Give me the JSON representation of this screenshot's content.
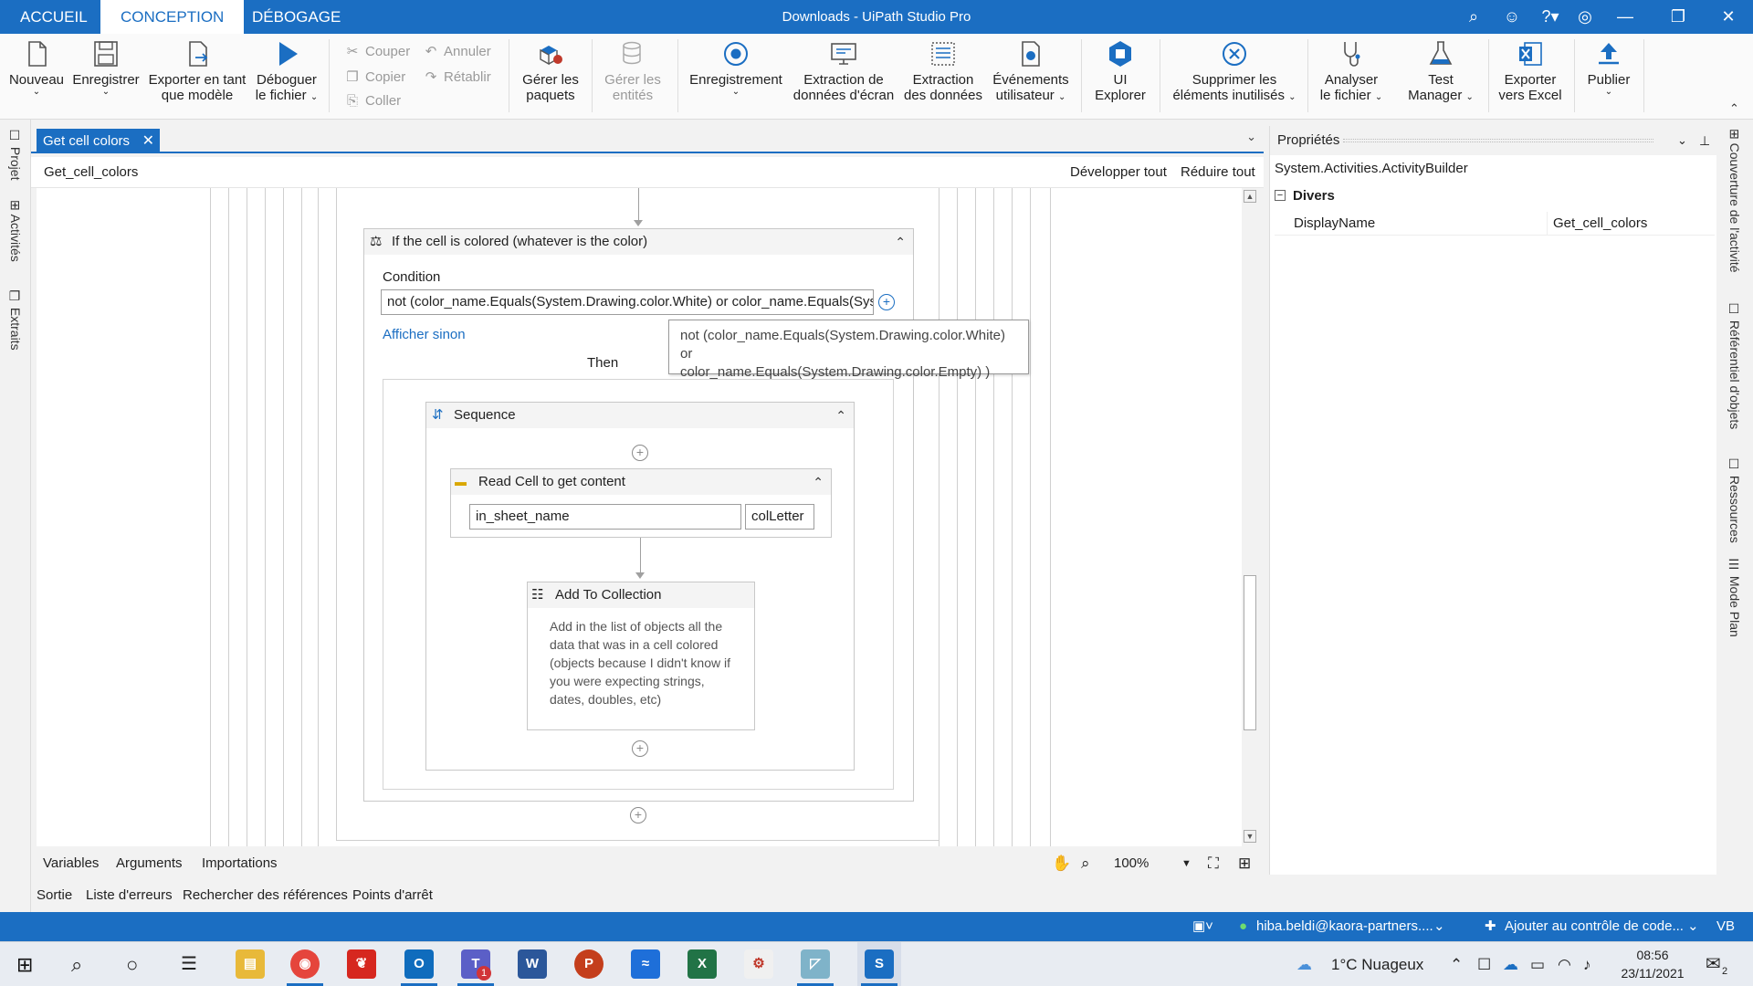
{
  "app": {
    "window_title": "Downloads - UiPath Studio Pro",
    "tabs": [
      "ACCUEIL",
      "CONCEPTION",
      "DÉBOGAGE"
    ]
  },
  "ribbon": {
    "nouveau": "Nouveau",
    "enregistrer": "Enregistrer",
    "exporter_modele_1": "Exporter en tant",
    "exporter_modele_2": "que modèle",
    "deboguer_1": "Déboguer",
    "deboguer_2": "le fichier",
    "couper": "Couper",
    "copier": "Copier",
    "coller": "Coller",
    "annuler": "Annuler",
    "retablir": "Rétablir",
    "gerer_paquets_1": "Gérer les",
    "gerer_paquets_2": "paquets",
    "gerer_entites_1": "Gérer les",
    "gerer_entites_2": "entités",
    "enregistrement": "Enregistrement",
    "extraction_ecran_1": "Extraction de",
    "extraction_ecran_2": "données d'écran",
    "extraction_donnees_1": "Extraction",
    "extraction_donnees_2": "des données",
    "evenements_1": "Événements",
    "evenements_2": "utilisateur",
    "ui_explorer_1": "UI",
    "ui_explorer_2": "Explorer",
    "supprimer_1": "Supprimer les",
    "supprimer_2": "éléments inutilisés",
    "analyser_1": "Analyser",
    "analyser_2": "le fichier",
    "test_1": "Test",
    "test_2": "Manager",
    "exporter_excel_1": "Exporter",
    "exporter_excel_2": "vers Excel",
    "publier": "Publier"
  },
  "left_rail": [
    "Projet",
    "Activités",
    "Extraits"
  ],
  "right_rail": [
    "Couverture de l'activité",
    "Référentiel d'objets",
    "Ressources",
    "Mode Plan"
  ],
  "document": {
    "tab": "Get cell colors",
    "breadcrumb": "Get_cell_colors",
    "expand_all": "Développer tout",
    "collapse_all": "Réduire tout"
  },
  "workflow": {
    "if_title": "If the cell is colored (whatever is the color)",
    "condition_label": "Condition",
    "condition_value": "not (color_name.Equals(System.Drawing.color.White) or color_name.Equals(System.Drawing.color.Empty) )",
    "show_else": "Afficher sinon",
    "then_label": "Then",
    "tooltip_line1": "not (color_name.Equals(System.Drawing.color.White) or",
    "tooltip_line2": "color_name.Equals(System.Drawing.color.Empty) )",
    "sequence_title": "Sequence",
    "readcell_title": "Read Cell to get content",
    "readcell_sheet": "in_sheet_name",
    "readcell_col": "colLetter",
    "addcollection_title": "Add To Collection",
    "addcollection_desc": "Add in the list of objects all the data that was in a cell colored (objects because I didn't know if you were expecting strings, dates, doubles, etc)"
  },
  "designer_bottom": {
    "tabs": [
      "Variables",
      "Arguments",
      "Importations"
    ],
    "zoom": "100%"
  },
  "output_tabs": [
    "Sortie",
    "Liste d'erreurs",
    "Rechercher des références",
    "Points d'arrêt"
  ],
  "properties": {
    "title": "Propriétés",
    "type": "System.Activities.ActivityBuilder",
    "category": "Divers",
    "rows": [
      {
        "name": "DisplayName",
        "value": "Get_cell_colors"
      }
    ]
  },
  "statusbar": {
    "user": "hiba.beldi@kaora-partners....",
    "source_control": "Ajouter au contrôle de code...",
    "lang": "VB"
  },
  "taskbar": {
    "weather": "1°C  Nuageux",
    "time": "08:56",
    "date": "23/11/2021",
    "notifications": "2",
    "teams_badge": "1"
  }
}
